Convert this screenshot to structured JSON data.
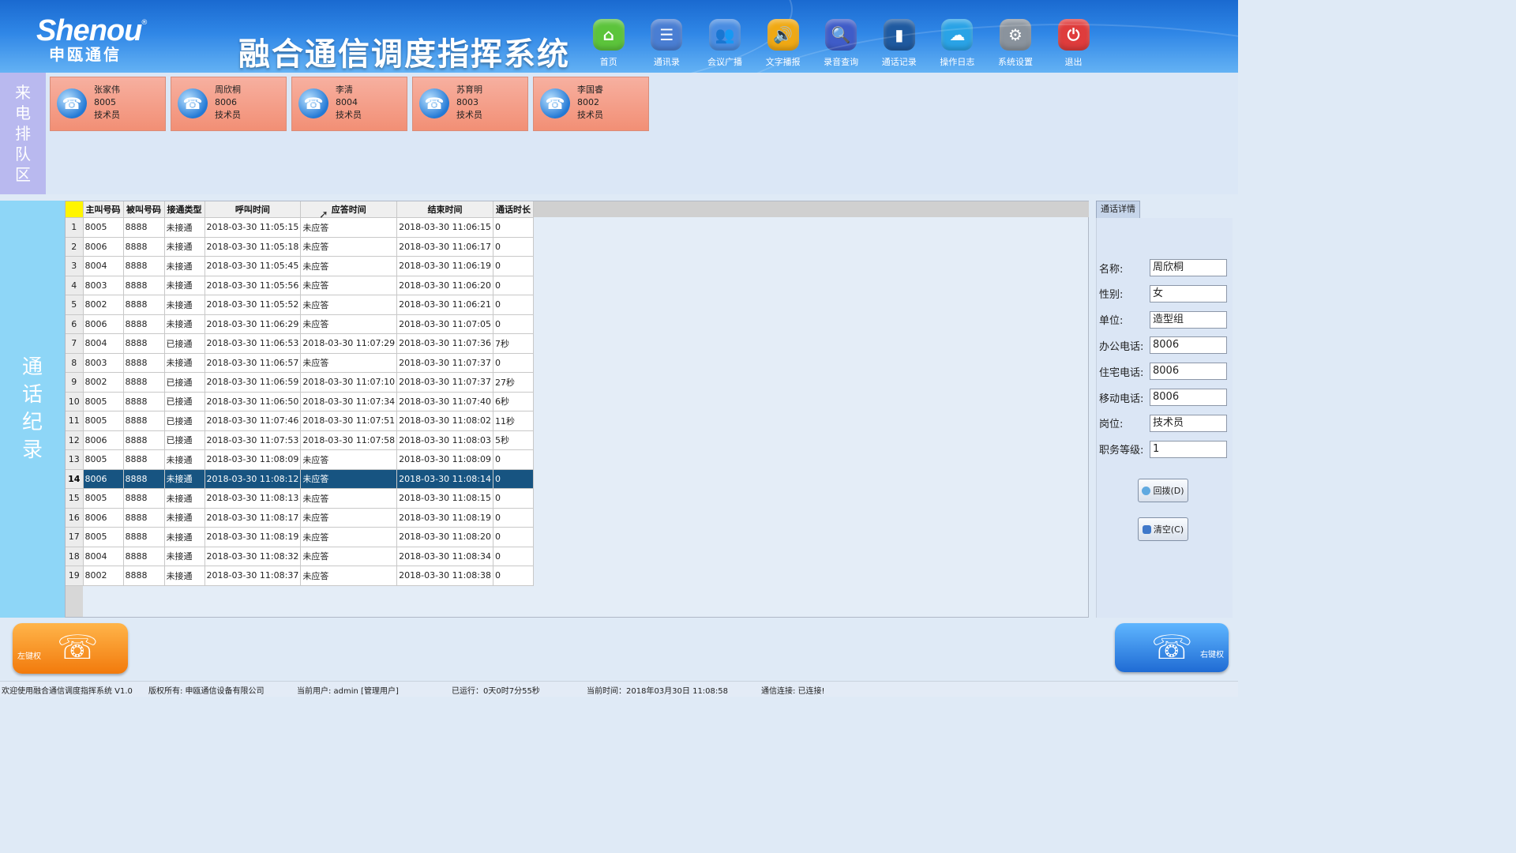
{
  "header": {
    "logo_en": "Shenou",
    "logo_cn": "申瓯通信",
    "logo_reg": "®",
    "title": "融合通信调度指挥系统",
    "nav": [
      {
        "label": "首页",
        "icon": "home-icon",
        "color": "#5cc43b",
        "glyph": "⌂"
      },
      {
        "label": "通讯录",
        "icon": "list-icon",
        "color": "#4a7ed3",
        "glyph": "☰"
      },
      {
        "label": "会议广播",
        "icon": "users-icon",
        "color": "#4a8de2",
        "glyph": "👥"
      },
      {
        "label": "文字播报",
        "icon": "speaker-icon",
        "color": "#f0a913",
        "glyph": "🔊"
      },
      {
        "label": "录音查询",
        "icon": "search-icon",
        "color": "#3f5cc8",
        "glyph": "🔍"
      },
      {
        "label": "通话记录",
        "icon": "record-icon",
        "color": "#1f5aa0",
        "glyph": "▮"
      },
      {
        "label": "操作日志",
        "icon": "cloud-icon",
        "color": "#2aa3e6",
        "glyph": "☁"
      },
      {
        "label": "系统设置",
        "icon": "gear-icon",
        "color": "#8a939d",
        "glyph": "⚙"
      },
      {
        "label": "退出",
        "icon": "power-icon",
        "color": "#df3c3c",
        "glyph": "⏻"
      }
    ]
  },
  "queue": {
    "label": [
      "来",
      "电",
      "排",
      "队",
      "区"
    ],
    "cards": [
      {
        "name": "张家伟",
        "number": "8005",
        "role": "技术员"
      },
      {
        "name": "周欣桐",
        "number": "8006",
        "role": "技术员"
      },
      {
        "name": "李清",
        "number": "8004",
        "role": "技术员"
      },
      {
        "name": "苏育明",
        "number": "8003",
        "role": "技术员"
      },
      {
        "name": "李国睿",
        "number": "8002",
        "role": "技术员"
      }
    ]
  },
  "records": {
    "label": [
      "通",
      "话",
      "纪",
      "录"
    ],
    "columns": [
      "主叫号码",
      "被叫号码",
      "接通类型",
      "呼叫时间",
      "应答时间",
      "结束时间",
      "通话时长"
    ],
    "selected_row": 14,
    "rows": [
      [
        "1",
        "8005",
        "8888",
        "未接通",
        "2018-03-30 11:05:15",
        "未应答",
        "2018-03-30 11:06:15",
        "0"
      ],
      [
        "2",
        "8006",
        "8888",
        "未接通",
        "2018-03-30 11:05:18",
        "未应答",
        "2018-03-30 11:06:17",
        "0"
      ],
      [
        "3",
        "8004",
        "8888",
        "未接通",
        "2018-03-30 11:05:45",
        "未应答",
        "2018-03-30 11:06:19",
        "0"
      ],
      [
        "4",
        "8003",
        "8888",
        "未接通",
        "2018-03-30 11:05:56",
        "未应答",
        "2018-03-30 11:06:20",
        "0"
      ],
      [
        "5",
        "8002",
        "8888",
        "未接通",
        "2018-03-30 11:05:52",
        "未应答",
        "2018-03-30 11:06:21",
        "0"
      ],
      [
        "6",
        "8006",
        "8888",
        "未接通",
        "2018-03-30 11:06:29",
        "未应答",
        "2018-03-30 11:07:05",
        "0"
      ],
      [
        "7",
        "8004",
        "8888",
        "已接通",
        "2018-03-30 11:06:53",
        "2018-03-30 11:07:29",
        "2018-03-30 11:07:36",
        "7秒"
      ],
      [
        "8",
        "8003",
        "8888",
        "未接通",
        "2018-03-30 11:06:57",
        "未应答",
        "2018-03-30 11:07:37",
        "0"
      ],
      [
        "9",
        "8002",
        "8888",
        "已接通",
        "2018-03-30 11:06:59",
        "2018-03-30 11:07:10",
        "2018-03-30 11:07:37",
        "27秒"
      ],
      [
        "10",
        "8005",
        "8888",
        "已接通",
        "2018-03-30 11:06:50",
        "2018-03-30 11:07:34",
        "2018-03-30 11:07:40",
        "6秒"
      ],
      [
        "11",
        "8005",
        "8888",
        "已接通",
        "2018-03-30 11:07:46",
        "2018-03-30 11:07:51",
        "2018-03-30 11:08:02",
        "11秒"
      ],
      [
        "12",
        "8006",
        "8888",
        "已接通",
        "2018-03-30 11:07:53",
        "2018-03-30 11:07:58",
        "2018-03-30 11:08:03",
        "5秒"
      ],
      [
        "13",
        "8005",
        "8888",
        "未接通",
        "2018-03-30 11:08:09",
        "未应答",
        "2018-03-30 11:08:09",
        "0"
      ],
      [
        "14",
        "8006",
        "8888",
        "未接通",
        "2018-03-30 11:08:12",
        "未应答",
        "2018-03-30 11:08:14",
        "0"
      ],
      [
        "15",
        "8005",
        "8888",
        "未接通",
        "2018-03-30 11:08:13",
        "未应答",
        "2018-03-30 11:08:15",
        "0"
      ],
      [
        "16",
        "8006",
        "8888",
        "未接通",
        "2018-03-30 11:08:17",
        "未应答",
        "2018-03-30 11:08:19",
        "0"
      ],
      [
        "17",
        "8005",
        "8888",
        "未接通",
        "2018-03-30 11:08:19",
        "未应答",
        "2018-03-30 11:08:20",
        "0"
      ],
      [
        "18",
        "8004",
        "8888",
        "未接通",
        "2018-03-30 11:08:32",
        "未应答",
        "2018-03-30 11:08:34",
        "0"
      ],
      [
        "19",
        "8002",
        "8888",
        "未接通",
        "2018-03-30 11:08:37",
        "未应答",
        "2018-03-30 11:08:38",
        "0"
      ]
    ]
  },
  "detail": {
    "tab": "通话详情",
    "fields": [
      {
        "label": "名称:",
        "value": "周欣桐"
      },
      {
        "label": "性别:",
        "value": "女"
      },
      {
        "label": "单位:",
        "value": "造型组"
      },
      {
        "label": "办公电话:",
        "value": "8006"
      },
      {
        "label": "住宅电话:",
        "value": "8006"
      },
      {
        "label": "移动电话:",
        "value": "8006"
      },
      {
        "label": "岗位:",
        "value": "技术员"
      },
      {
        "label": "职务等级:",
        "value": "1"
      }
    ],
    "callback_label": "回拨(D)",
    "clear_label": "清空(C)"
  },
  "phones": {
    "left_label": "左键权",
    "right_label": "右键权"
  },
  "status": {
    "welcome": "欢迎使用融合通信调度指挥系统 V1.0",
    "copyright": "版权所有: 申瓯通信设备有限公司",
    "user": "当前用户: admin [管理用户]",
    "uptime": "已运行：0天0时7分55秒",
    "time": "当前时间：2018年03月30日 11:08:58",
    "connection": "通信连接: 已连接!"
  }
}
